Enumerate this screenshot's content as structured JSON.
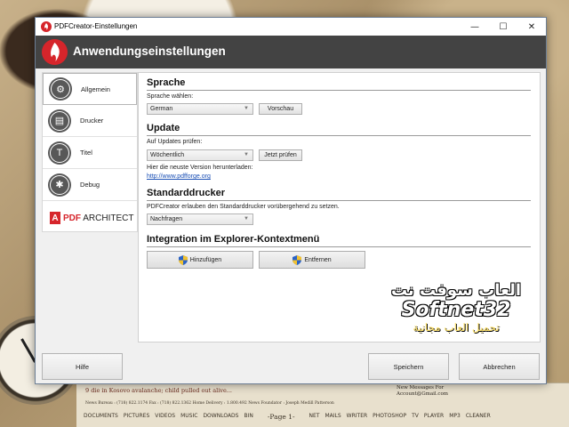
{
  "window": {
    "title": "PDFCreator-Einstellungen",
    "header_title": "Anwendungseinstellungen",
    "controls": {
      "minimize": "—",
      "maximize": "☐",
      "close": "✕"
    }
  },
  "sidebar": {
    "items": [
      {
        "label": "Allgemein",
        "icon": "gear-icon",
        "glyph": "⚙",
        "active": true
      },
      {
        "label": "Drucker",
        "icon": "printer-icon",
        "glyph": "▤",
        "active": false
      },
      {
        "label": "Titel",
        "icon": "title-icon",
        "glyph": "T",
        "active": false
      },
      {
        "label": "Debug",
        "icon": "bug-icon",
        "glyph": "✱",
        "active": false
      }
    ],
    "architect": {
      "badge": "A",
      "brand": "PDF",
      "name": "ARCHITECT"
    }
  },
  "language": {
    "section_title": "Sprache",
    "label": "Sprache wählen:",
    "selected": "German",
    "preview_button": "Vorschau"
  },
  "update": {
    "section_title": "Update",
    "label": "Auf Updates prüfen:",
    "selected": "Wöchentlich",
    "check_button": "Jetzt prüfen",
    "download_label": "Hier die neuste Version herunterladen:",
    "download_link": "http://www.pdfforge.org"
  },
  "default_printer": {
    "section_title": "Standarddrucker",
    "label": "PDFCreator erlauben den Standarddrucker vorübergehend zu setzen.",
    "selected": "Nachfragen"
  },
  "explorer_integration": {
    "section_title": "Integration im Explorer-Kontextmenü",
    "add_button": "Hinzufügen",
    "remove_button": "Entfernen"
  },
  "footer": {
    "help_button": "Hilfe",
    "save_button": "Speichern",
    "cancel_button": "Abbrechen"
  },
  "desktop": {
    "headline": "9 die in Kosovo avalanche; child pulled out alive...",
    "info_line": "News Bureau : (718) 822.1174   Fax : (718) 822.1362   Home Delivery : 1.800.492 News   Foundator : Joseph Medill Patterson",
    "message_line1": "New Messages For",
    "message_line2": "Account@Gmail.com",
    "shortcuts": [
      "DOCUMENTS",
      "PICTURES",
      "VIDEOS",
      "MUSIC",
      "DOWNLOADS",
      "BIN",
      "-Page 1-",
      "NET",
      "MAILS",
      "WRITER",
      "PHOTOSHOP",
      "TV",
      "PLAYER",
      "MP3",
      "CLEANER"
    ],
    "watermark_ar1": "العاب سوفت نت",
    "watermark_latin": "Softnet32",
    "watermark_ar2": "تحميل العاب مجانية"
  },
  "colors": {
    "header_bg": "#434343",
    "accent_red": "#d6252b",
    "link_blue": "#1a4fb5"
  }
}
